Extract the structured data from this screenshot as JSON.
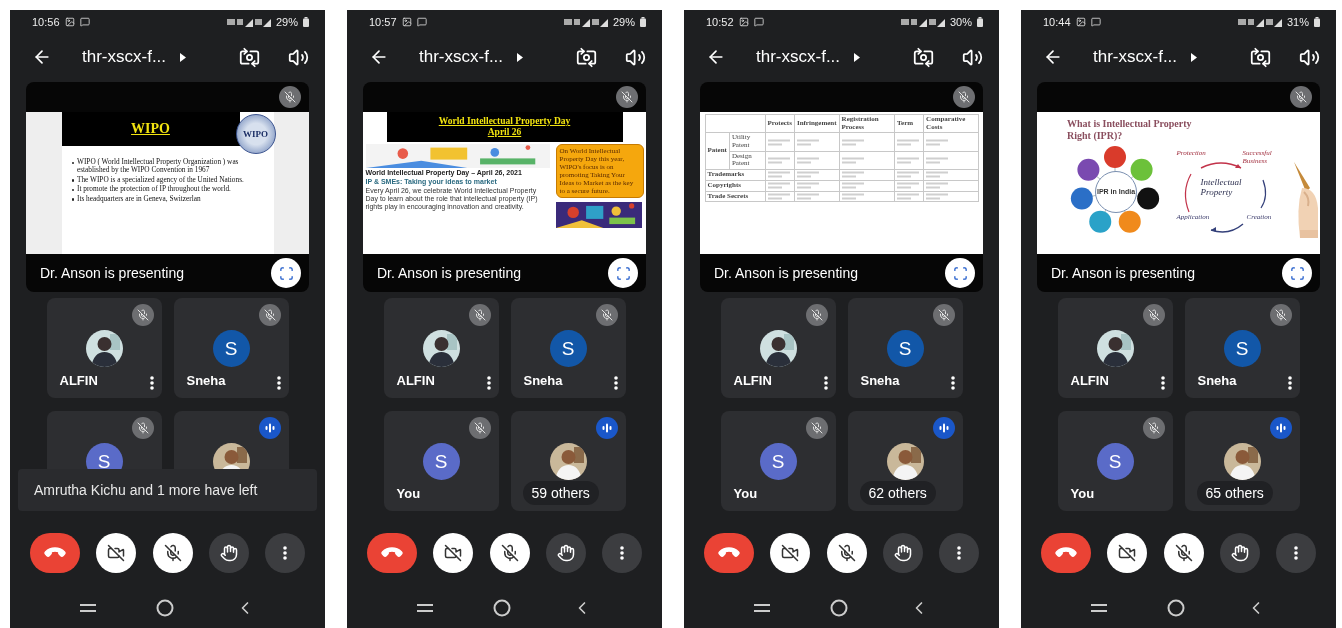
{
  "phones": [
    {
      "status_bar": {
        "time": "10:56",
        "battery": "29%"
      },
      "call_title": "thr-xscx-f...",
      "presentation": {
        "muted": true,
        "presenter_label": "Dr. Anson is presenting",
        "slide": {
          "kind": "wipo",
          "title": "WIPO",
          "logo_text": "WIPO",
          "bullets": [
            "WIPO ( World Intellectual Property Organization ) was established by the WIPO Convention in 1967",
            "The WIPO is a specialized agency of the United Nations.",
            "It promote the protection of IP throughout the world.",
            "Its headquarters are in Geneva, Switzerlan"
          ]
        }
      },
      "tiles": [
        {
          "name": "ALFIN",
          "muted": true,
          "speaking": false,
          "menu": true
        },
        {
          "name": "Sneha",
          "avatar": {
            "kind": "letter",
            "letter": "S",
            "color": "#1257a8"
          },
          "muted": true,
          "speaking": false,
          "menu": true
        },
        {
          "avatar": {
            "kind": "letter",
            "letter": "S",
            "color": "#5a6bc8"
          },
          "muted": true,
          "speaking": false,
          "menu": false
        },
        {
          "muted": false,
          "speaking": true,
          "menu": false
        }
      ],
      "toast": "Amrutha Kichu and 1 more have left",
      "controls": [
        {
          "kind": "hangup"
        },
        {
          "kind": "camera",
          "on": false
        },
        {
          "kind": "mic",
          "on": false
        },
        {
          "kind": "hand"
        },
        {
          "kind": "more"
        }
      ]
    },
    {
      "status_bar": {
        "time": "10:57",
        "battery": "29%"
      },
      "call_title": "thr-xscx-f...",
      "presentation": {
        "muted": true,
        "presenter_label": "Dr. Anson is presenting",
        "slide": {
          "kind": "ipday",
          "title_lines": [
            "World Intellectual Property Day",
            "April 26"
          ],
          "callout": "On World Intellectual Property Day this year, WIPO's focus is on promoting Taking Your Ideas to Market as the key to a secure future.",
          "caption": "World Intellectual Property Day – April 26, 2021",
          "subtitle": "IP & SMEs: Taking your ideas to market",
          "body": "Every April 26, we celebrate World Intellectual Property Day to learn about the role that intellectual property (IP) rights play in encouraging innovation and creativity."
        }
      },
      "tiles": [
        {
          "name": "ALFIN",
          "muted": true,
          "speaking": false,
          "menu": true
        },
        {
          "name": "Sneha",
          "avatar": {
            "kind": "letter",
            "letter": "S",
            "color": "#1257a8"
          },
          "muted": true,
          "speaking": false,
          "menu": true
        },
        {
          "name": "You",
          "avatar": {
            "kind": "letter",
            "letter": "S",
            "color": "#5a6bc8"
          },
          "muted": true,
          "speaking": false,
          "menu": false
        },
        {
          "muted": false,
          "speaking": true,
          "menu": false,
          "others": "59 others"
        }
      ],
      "controls": [
        {
          "kind": "hangup"
        },
        {
          "kind": "camera",
          "on": false
        },
        {
          "kind": "mic",
          "on": false
        },
        {
          "kind": "hand"
        },
        {
          "kind": "more"
        }
      ]
    },
    {
      "status_bar": {
        "time": "10:52",
        "battery": "30%"
      },
      "call_title": "thr-xscx-f...",
      "presentation": {
        "muted": true,
        "presenter_label": "Dr. Anson is presenting",
        "slide": {
          "kind": "table",
          "columns": [
            "Protects",
            "Infringement",
            "Registration Process",
            "Term",
            "Comparative Costs"
          ],
          "rows": [
            {
              "label": "Patent",
              "sub": "Utility Patent"
            },
            {
              "sub": "Design Patent"
            },
            {
              "label": "Trademarks"
            },
            {
              "label": "Copyrights"
            },
            {
              "label": "Trade Secrets"
            }
          ]
        }
      },
      "tiles": [
        {
          "name": "ALFIN",
          "muted": true,
          "speaking": false,
          "menu": true
        },
        {
          "name": "Sneha",
          "avatar": {
            "kind": "letter",
            "letter": "S",
            "color": "#1257a8"
          },
          "muted": true,
          "speaking": false,
          "menu": true
        },
        {
          "name": "You",
          "avatar": {
            "kind": "letter",
            "letter": "S",
            "color": "#5a6bc8"
          },
          "muted": true,
          "speaking": false,
          "menu": false
        },
        {
          "muted": false,
          "speaking": true,
          "menu": false,
          "others": "62 others"
        }
      ],
      "controls": [
        {
          "kind": "hangup"
        },
        {
          "kind": "camera",
          "on": false
        },
        {
          "kind": "mic",
          "on": false
        },
        {
          "kind": "hand"
        },
        {
          "kind": "more"
        }
      ]
    },
    {
      "status_bar": {
        "time": "10:44",
        "battery": "31%"
      },
      "call_title": "thr-xscx-f...",
      "presentation": {
        "muted": true,
        "presenter_label": "Dr. Anson is presenting",
        "slide": {
          "kind": "ipr",
          "title": "What is Intellectual Property Right (IPR)?",
          "hub": "IPR in India",
          "cycle_center": "Intellectual Property",
          "cycle_labels": [
            "Protection",
            "Successful Business",
            "Application",
            "Creation"
          ]
        }
      },
      "tiles": [
        {
          "name": "ALFIN",
          "muted": true,
          "speaking": false,
          "menu": true
        },
        {
          "name": "Sneha",
          "avatar": {
            "kind": "letter",
            "letter": "S",
            "color": "#1257a8"
          },
          "muted": true,
          "speaking": false,
          "menu": true
        },
        {
          "name": "You",
          "avatar": {
            "kind": "letter",
            "letter": "S",
            "color": "#5a6bc8"
          },
          "muted": true,
          "speaking": false,
          "menu": false
        },
        {
          "muted": false,
          "speaking": true,
          "menu": false,
          "others": "65 others"
        }
      ],
      "controls": [
        {
          "kind": "hangup"
        },
        {
          "kind": "camera",
          "on": false
        },
        {
          "kind": "mic",
          "on": false
        },
        {
          "kind": "hand"
        },
        {
          "kind": "more"
        }
      ]
    }
  ]
}
